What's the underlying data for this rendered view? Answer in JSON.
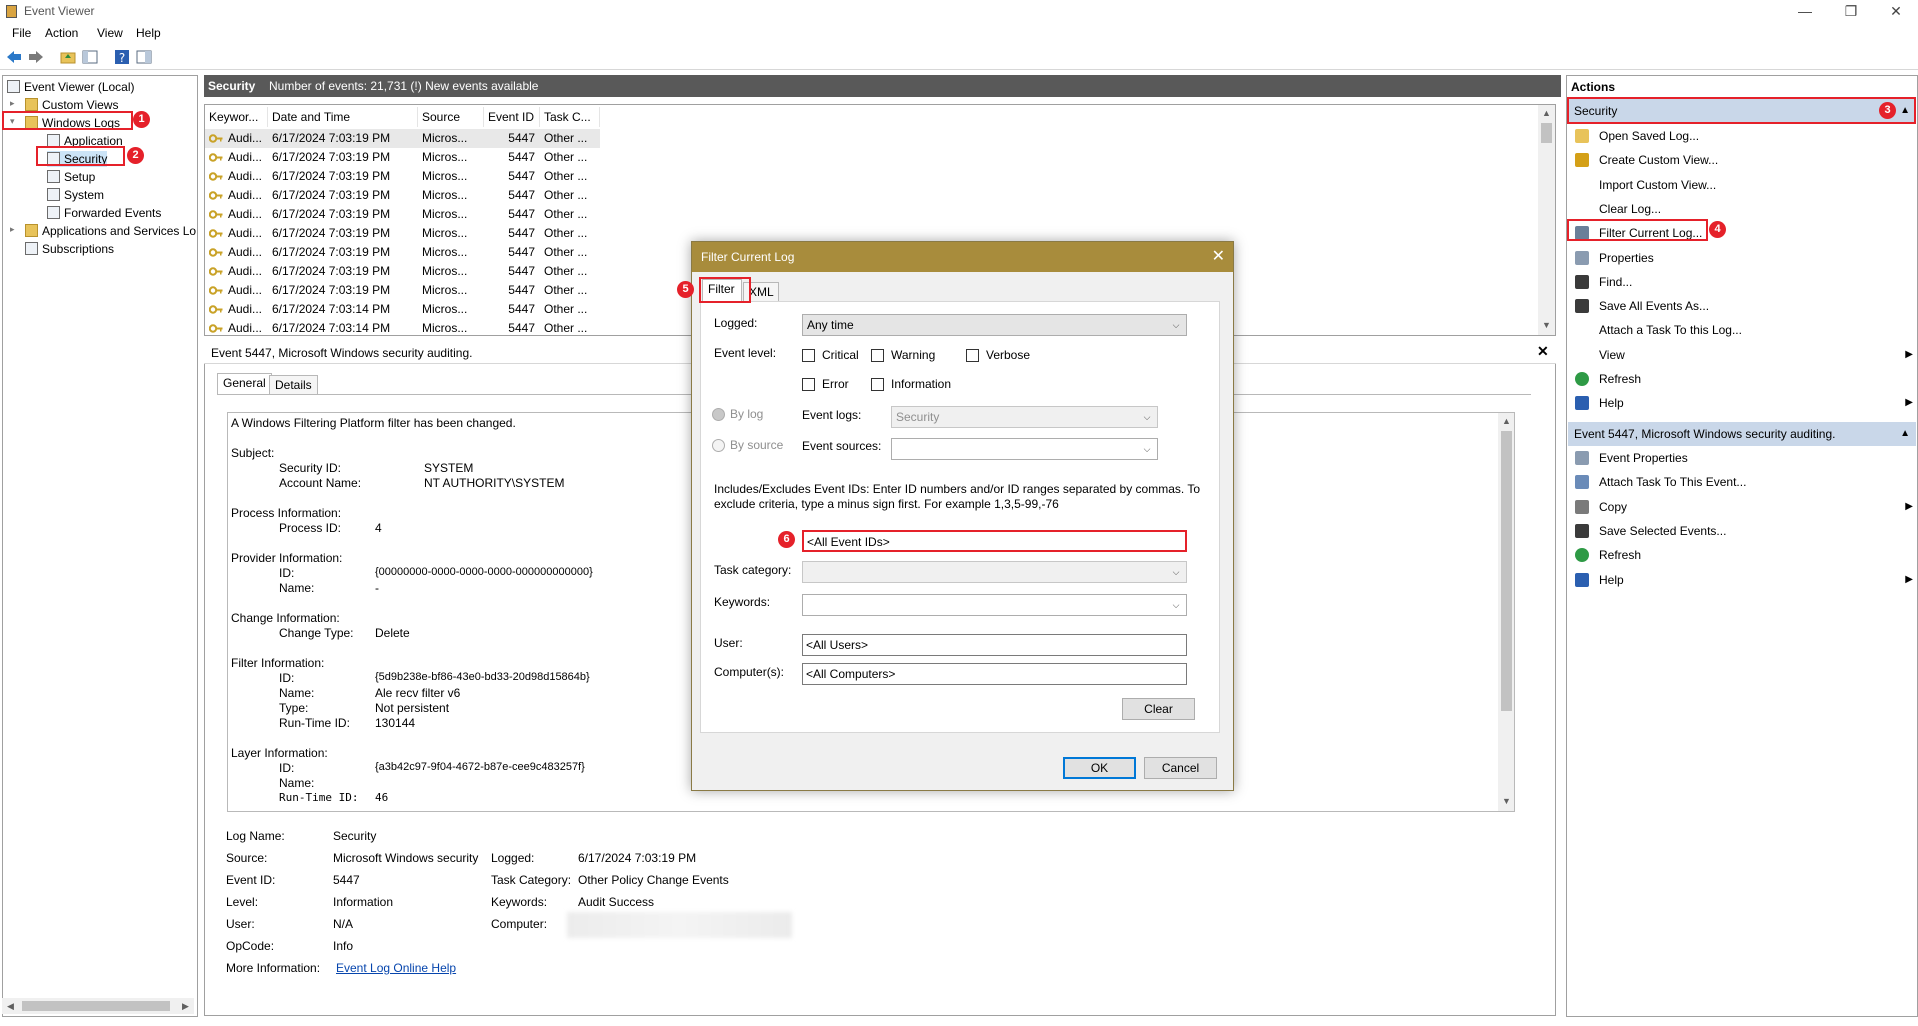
{
  "window": {
    "title": "Event Viewer",
    "min": "—",
    "restore": "❐",
    "close": "✕"
  },
  "menu": [
    "File",
    "Action",
    "View",
    "Help"
  ],
  "tree": {
    "root": "Event Viewer (Local)",
    "custom_views": "Custom Views",
    "windows_logs": "Windows Logs",
    "application": "Application",
    "security": "Security",
    "setup": "Setup",
    "system": "System",
    "forwarded": "Forwarded Events",
    "apps_services": "Applications and Services Lo",
    "subscriptions": "Subscriptions"
  },
  "badges": [
    "1",
    "2",
    "3",
    "4",
    "5",
    "6"
  ],
  "list": {
    "title": "Security",
    "count": "Number of events: 21,731 (!) New events available",
    "columns": [
      "Keywor...",
      "Date and Time",
      "Source",
      "Event ID",
      "Task C..."
    ],
    "rows": [
      {
        "kw": "Audi...",
        "dt": "6/17/2024 7:03:19 PM",
        "src": "Micros...",
        "id": "5447",
        "task": "Other ..."
      },
      {
        "kw": "Audi...",
        "dt": "6/17/2024 7:03:19 PM",
        "src": "Micros...",
        "id": "5447",
        "task": "Other ..."
      },
      {
        "kw": "Audi...",
        "dt": "6/17/2024 7:03:19 PM",
        "src": "Micros...",
        "id": "5447",
        "task": "Other ..."
      },
      {
        "kw": "Audi...",
        "dt": "6/17/2024 7:03:19 PM",
        "src": "Micros...",
        "id": "5447",
        "task": "Other ..."
      },
      {
        "kw": "Audi...",
        "dt": "6/17/2024 7:03:19 PM",
        "src": "Micros...",
        "id": "5447",
        "task": "Other ..."
      },
      {
        "kw": "Audi...",
        "dt": "6/17/2024 7:03:19 PM",
        "src": "Micros...",
        "id": "5447",
        "task": "Other ..."
      },
      {
        "kw": "Audi...",
        "dt": "6/17/2024 7:03:19 PM",
        "src": "Micros...",
        "id": "5447",
        "task": "Other ..."
      },
      {
        "kw": "Audi...",
        "dt": "6/17/2024 7:03:19 PM",
        "src": "Micros...",
        "id": "5447",
        "task": "Other ..."
      },
      {
        "kw": "Audi...",
        "dt": "6/17/2024 7:03:19 PM",
        "src": "Micros...",
        "id": "5447",
        "task": "Other ..."
      },
      {
        "kw": "Audi...",
        "dt": "6/17/2024 7:03:14 PM",
        "src": "Micros...",
        "id": "5447",
        "task": "Other ..."
      },
      {
        "kw": "Audi...",
        "dt": "6/17/2024 7:03:14 PM",
        "src": "Micros...",
        "id": "5447",
        "task": "Other ..."
      },
      {
        "kw": "Audi...",
        "dt": "6/17/2024 7:03:14 PM",
        "src": "Micros...",
        "id": "5447",
        "task": "Other ..."
      }
    ]
  },
  "detail": {
    "header": "Event 5447, Microsoft Windows security auditing.",
    "tabs": [
      "General",
      "Details"
    ],
    "desc": "A Windows Filtering Platform filter has been changed.",
    "subject": "Subject:",
    "security_id_label": "Security ID:",
    "security_id": "SYSTEM",
    "account_name_label": "Account Name:",
    "account_name": "NT AUTHORITY\\SYSTEM",
    "process_info": "Process Information:",
    "process_id_label": "Process ID:",
    "process_id": "4",
    "provider_info": "Provider Information:",
    "id_label": "ID:",
    "provider_id": "{00000000-0000-0000-0000-000000000000}",
    "name_label": "Name:",
    "provider_name": "-",
    "change_info": "Change Information:",
    "change_type_label": "Change Type:",
    "change_type": "Delete",
    "filter_info": "Filter Information:",
    "filter_id": "{5d9b238e-bf86-43e0-bd33-20d98d15864b}",
    "filter_name": "Ale recv filter v6",
    "type_label": "Type:",
    "filter_type": "Not persistent",
    "runtime_label": "Run-Time ID:",
    "filter_runtime": "130144",
    "layer_info": "Layer Information:",
    "layer_id": "{a3b42c97-9f04-4672-b87e-cee9c483257f}",
    "layer_name_label": "Name:",
    "layer_runtime_label": "Run-Time ID:",
    "layer_runtime": "46",
    "fields": {
      "log_name_label": "Log Name:",
      "log_name": "Security",
      "source_label": "Source:",
      "source": "Microsoft Windows security",
      "logged_label": "Logged:",
      "logged": "6/17/2024 7:03:19 PM",
      "event_id_label": "Event ID:",
      "event_id": "5447",
      "task_cat_label": "Task Category:",
      "task_cat": "Other Policy Change Events",
      "level_label": "Level:",
      "level": "Information",
      "keywords_label": "Keywords:",
      "keywords": "Audit Success",
      "user_label": "User:",
      "user": "N/A",
      "computer_label": "Computer:",
      "opcode_label": "OpCode:",
      "opcode": "Info",
      "more_info_label": "More Information:",
      "more_info_link": "Event Log Online Help"
    }
  },
  "actions": {
    "title": "Actions",
    "group1": "Security",
    "items1": [
      "Open Saved Log...",
      "Create Custom View...",
      "Import Custom View...",
      "Clear Log...",
      "Filter Current Log...",
      "Properties",
      "Find...",
      "Save All Events As...",
      "Attach a Task To this Log...",
      "View",
      "Refresh",
      "Help"
    ],
    "group2": "Event 5447, Microsoft Windows security auditing.",
    "items2": [
      "Event Properties",
      "Attach Task To This Event...",
      "Copy",
      "Save Selected Events...",
      "Refresh",
      "Help"
    ]
  },
  "dialog": {
    "title": "Filter Current Log",
    "tabs": [
      "Filter",
      "XML"
    ],
    "logged_label": "Logged:",
    "logged_value": "Any time",
    "event_level_label": "Event level:",
    "levels": [
      "Critical",
      "Warning",
      "Verbose",
      "Error",
      "Information"
    ],
    "by_log": "By log",
    "by_source": "By source",
    "event_logs_label": "Event logs:",
    "event_logs_value": "Security",
    "event_sources_label": "Event sources:",
    "includes_text_1": "Includes/Excludes Event IDs: Enter ID numbers and/or ID ranges separated by commas. To",
    "includes_text_2": "exclude criteria, type a minus sign first. For example 1,3,5-99,-76",
    "event_ids_value": "<All Event IDs>",
    "task_category_label": "Task category:",
    "keywords_label": "Keywords:",
    "user_label": "User:",
    "user_value": "<All Users>",
    "computers_label": "Computer(s):",
    "computers_value": "<All Computers>",
    "clear": "Clear",
    "ok": "OK",
    "cancel": "Cancel"
  }
}
